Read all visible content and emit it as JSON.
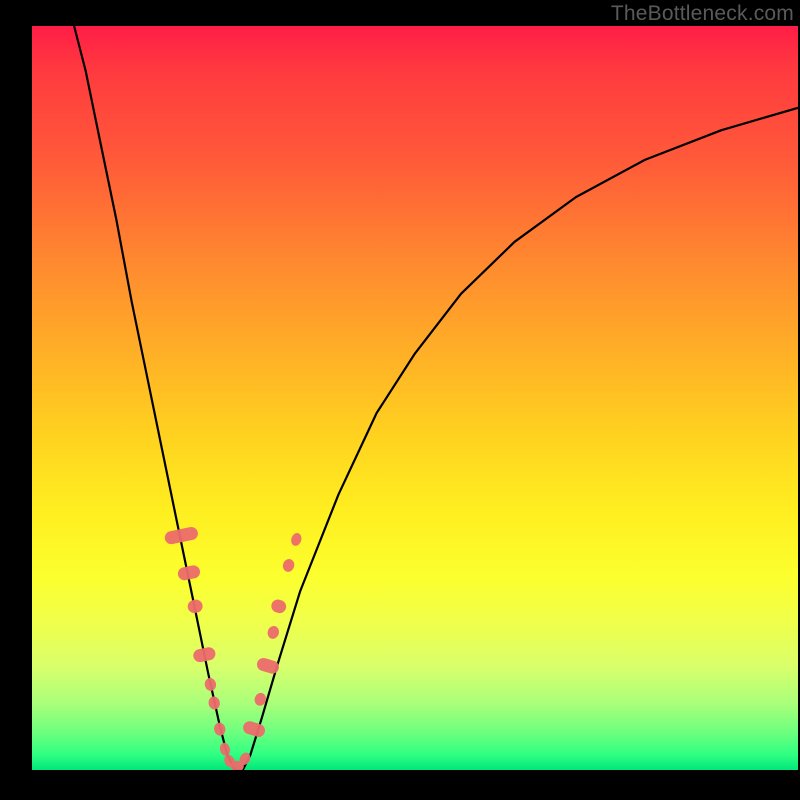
{
  "watermark": "TheBottleneck.com",
  "chart_data": {
    "type": "line",
    "description": "Bottleneck-style V-curve chart: a steep valley curve dipping to zero around x≈0.26 overlaid on a red-to-green vertical gradient background. No axes, ticks, labels, or legend are shown. Scattered salmon markers lie along the lower flanks of the curve.",
    "xlim": [
      0,
      1
    ],
    "ylim": [
      0,
      1
    ],
    "title": "",
    "xlabel": "",
    "ylabel": "",
    "series": [
      {
        "name": "curve",
        "x": [
          0.055,
          0.07,
          0.09,
          0.11,
          0.13,
          0.15,
          0.17,
          0.19,
          0.21,
          0.23,
          0.245,
          0.255,
          0.265,
          0.275,
          0.285,
          0.3,
          0.32,
          0.35,
          0.4,
          0.45,
          0.5,
          0.56,
          0.63,
          0.71,
          0.8,
          0.9,
          1.0
        ],
        "y": [
          1.0,
          0.94,
          0.84,
          0.74,
          0.63,
          0.53,
          0.43,
          0.33,
          0.23,
          0.13,
          0.06,
          0.02,
          0.0,
          0.0,
          0.02,
          0.07,
          0.14,
          0.24,
          0.37,
          0.48,
          0.56,
          0.64,
          0.71,
          0.77,
          0.82,
          0.86,
          0.89
        ]
      }
    ],
    "markers": {
      "note": "Salmon elongated/round markers plotted near the valley on both sides of the curve. Values approximate.",
      "color": "#ec6b6b",
      "points": [
        {
          "x": 0.195,
          "y": 0.315,
          "len": 0.045
        },
        {
          "x": 0.205,
          "y": 0.265,
          "len": 0.03
        },
        {
          "x": 0.213,
          "y": 0.22,
          "len": 0.02
        },
        {
          "x": 0.225,
          "y": 0.155,
          "len": 0.03
        },
        {
          "x": 0.233,
          "y": 0.115,
          "len": 0.015
        },
        {
          "x": 0.238,
          "y": 0.09,
          "len": 0.015
        },
        {
          "x": 0.245,
          "y": 0.055,
          "len": 0.015
        },
        {
          "x": 0.252,
          "y": 0.028,
          "len": 0.012
        },
        {
          "x": 0.258,
          "y": 0.012,
          "len": 0.01
        },
        {
          "x": 0.268,
          "y": 0.005,
          "len": 0.015
        },
        {
          "x": 0.278,
          "y": 0.015,
          "len": 0.012
        },
        {
          "x": 0.29,
          "y": 0.055,
          "len": 0.03
        },
        {
          "x": 0.298,
          "y": 0.095,
          "len": 0.015
        },
        {
          "x": 0.308,
          "y": 0.14,
          "len": 0.03
        },
        {
          "x": 0.315,
          "y": 0.185,
          "len": 0.015
        },
        {
          "x": 0.322,
          "y": 0.22,
          "len": 0.02
        },
        {
          "x": 0.335,
          "y": 0.275,
          "len": 0.015
        },
        {
          "x": 0.345,
          "y": 0.31,
          "len": 0.012
        }
      ]
    },
    "gradient_stops": [
      {
        "pos": 0.0,
        "color": "#ff1d47"
      },
      {
        "pos": 0.3,
        "color": "#ff8a2f"
      },
      {
        "pos": 0.6,
        "color": "#ffee20"
      },
      {
        "pos": 0.9,
        "color": "#aaff7a"
      },
      {
        "pos": 1.0,
        "color": "#00e67a"
      }
    ]
  }
}
